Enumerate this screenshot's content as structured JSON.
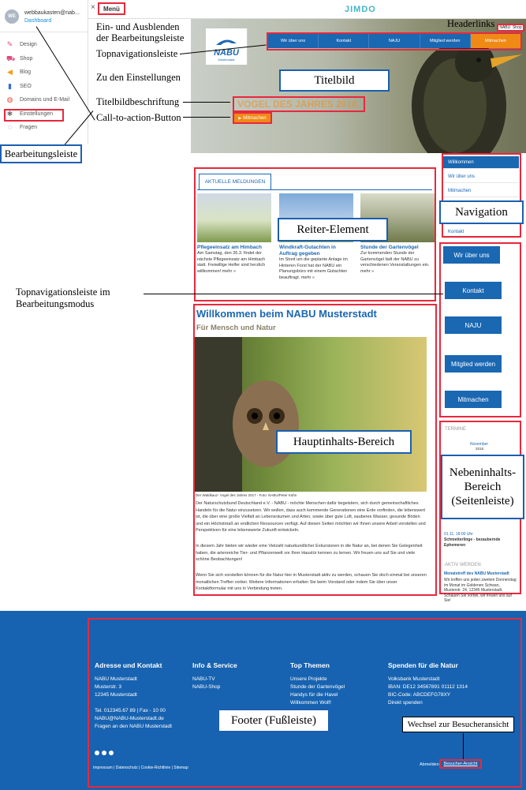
{
  "sidebar": {
    "avatar": "WE",
    "user": "webbaukasten@nab...",
    "dashboard": "Dashboard",
    "items": [
      {
        "label": "Design",
        "color": "#e0487d",
        "icon": "brush-icon"
      },
      {
        "label": "Shop",
        "color": "#e0487d",
        "icon": "cart-icon"
      },
      {
        "label": "Blog",
        "color": "#f39c12",
        "icon": "megaphone-icon"
      },
      {
        "label": "SEO",
        "color": "#3a6fc9",
        "icon": "bar-chart-icon"
      },
      {
        "label": "Domains und E-Mail",
        "color": "#e74c3c",
        "icon": "globe-icon"
      },
      {
        "label": "Einstellungen",
        "color": "#777777",
        "icon": "wrench-icon"
      },
      {
        "label": "Fragen",
        "color": "#555555",
        "icon": "speech-bubble-icon"
      }
    ]
  },
  "topbar": {
    "menu": "Menü",
    "logo": "JIMDO"
  },
  "header_links": [
    "NABU",
    "Shop"
  ],
  "top_nav": [
    "Wir über uns",
    "Kontakt",
    "NAJU",
    "Mitglied werden",
    "Mitmachen"
  ],
  "hero": {
    "caption": "VOGEL DES JAHRES 2018",
    "cta": "Mitmachen",
    "logo": "NABU",
    "logo_sub": "Musterstadt"
  },
  "annotations": {
    "toggle": "Ein- und Ausblenden der Bearbeitungsleiste",
    "topnav": "Topnavigationsleiste",
    "settings": "Zu den Einstellungen",
    "caption": "Titelbildbeschriftung",
    "cta": "Call-to-action-Button",
    "edit_bar": "Bearbeitungsleiste",
    "header_links": "Headerlinks",
    "hero": "Titelbild",
    "navigation": "Navigation",
    "tabs": "Reiter-Element",
    "topnav_edit": "Topnavigationsleiste im Bearbeitungsmodus",
    "main": "Hauptinhalts-Bereich",
    "side": "Nebeninhalts-Bereich (Seitenleiste)",
    "footer": "Footer (Fußleiste)",
    "visitor": "Wechsel zur Besucheransicht"
  },
  "side_nav": [
    "Willkommen",
    "Wir über uns",
    "Mitmachen",
    "Kontakt"
  ],
  "tabs": {
    "title": "AKTUELLE MELDUNGEN",
    "cards": [
      {
        "title": "Pflegeeinsatz am Himbach",
        "text": "Am Samstag, den 26.3. findet der nächste Pflegeeinsatz am Himbach statt. Freiwillige Helfer sind herzlich willkommen! mehr »"
      },
      {
        "title": "Windkraft-Gutachten in Auftrag gegeben",
        "text": "Im Streit um die geplante Anlage im Hinteren Forst hat der NABU ein Planungsbüro mit einem Gutachten beauftragt. mehr »"
      },
      {
        "title": "Stunde der Gartenvögel",
        "text": "Zur kommenden Stunde der Gartenvögel lädt der NABU zu verschiedenen Veranstaltungen ein. mehr »"
      }
    ]
  },
  "vertical_nav": [
    "Wir über uns",
    "Kontakt",
    "NAJU",
    "Mitglied werden",
    "Mitmachen"
  ],
  "main": {
    "title": "Willkommen beim NABU Musterstadt",
    "subtitle": "Für Mensch und Natur",
    "photo_caption": "Der Waldkauz- Vogel des Jahres 2017 - Foto: NABU/Peter Kühn",
    "p1": "Der Naturschutzbund Deutschland e.V. - NABU - möchte Menschen dafür begeistern, sich durch gemeinschaftliches Handeln für die Natur einzusetzen. Wir wollen, dass auch kommende Generationen eine Erde vorfinden, die lebenswert ist, die über eine große Vielfalt an Lebensräumen und Arten, sowie über gute Luft, sauberes Wasser, gesunde Böden und ein Höchstmaß an endlichen Ressourcen verfügt. Auf diesen Seiten möchten wir Ihnen unsere Arbeit vorstellen und Perspektiven für eine lebenswerte Zukunft entwickeln.",
    "p2": "In diesem Jahr bieten wir wieder eine Vielzahl naturkundlicher Exkursionen in die Natur an, bei denen Sie Gelegenheit haben, die artenreiche Tier- und Pflanzenwelt vor Ihrer Haustür kennen zu lernen. Wir freuen uns auf Sie und viele schöne Beobachtungen!",
    "p3": "Wenn Sie sich vorstellen können für die Natur hier in Musterstadt aktiv zu werden, schauen Sie doch einmal bei unseren monatlichen Treffen vorbei. Weitere Informationen erhalten Sie beim Vorstand oder indem Sie über unser Kontaktformular mit uns in Verbindung treten."
  },
  "side": {
    "termine": "TERMINE",
    "month": "November",
    "year": "2018",
    "event_date": "01.11. 18:00 Uhr",
    "event_title": "Schmetterlinge - bezaubernde Ephemeren",
    "aktiv": "AKTIV WERDEN",
    "aktiv_title": "Monatstreff des NABU Musterstadt",
    "aktiv_text": "Wir treffen uns jeden zweiten Donnerstag im Monat im Goldenen Schwan, Musterstr. 24, 12345 Musterstadt. Schauen Sie vorbei, wir freuen uns auf Sie!"
  },
  "footer": {
    "cols": [
      {
        "head": "Adresse und Kontakt",
        "lines": [
          "NABU Musterstadt",
          "Musterstr. 3",
          "12345 Musterstadt",
          "",
          "Tel. 012345.67 89 | Fax - 10 00",
          "NABU@NABU-Musterstadt.de",
          "Fragen an den NABU Musterstadt"
        ]
      },
      {
        "head": "Info & Service",
        "lines": [
          "NABU-TV",
          "NABU-Shop"
        ]
      },
      {
        "head": "Top Themen",
        "lines": [
          "Unsere Projekte",
          "Stunde der Gartenvögel",
          "Handys für die Havel",
          "Willkommen Wolf!"
        ]
      },
      {
        "head": "Spenden für die Natur",
        "lines": [
          "Volksbank Musterstadt",
          "IBAN: DE12 34567891 01112 1314",
          "BIC-Code: ABCDEFG78XY",
          "Direkt spenden"
        ]
      }
    ],
    "legal": "Impressum | Datenschutz | Cookie-Richtlinie | Sitemap",
    "logout": "Abmelden",
    "visitor": "Besucher-Ansicht"
  }
}
